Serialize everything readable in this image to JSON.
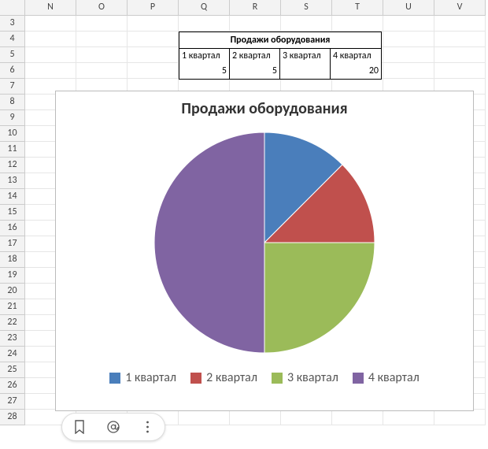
{
  "columns": [
    "N",
    "O",
    "P",
    "Q",
    "R",
    "S",
    "T",
    "U",
    "V"
  ],
  "row_numbers": [
    3,
    4,
    5,
    6,
    7,
    8,
    9,
    10,
    11,
    12,
    13,
    14,
    15,
    16,
    17,
    18,
    19,
    20,
    21,
    22,
    23,
    24,
    25,
    26,
    27,
    28
  ],
  "table": {
    "title": "Продажи оборудования",
    "headers": [
      "1 квартал",
      "2 квартал",
      "3 квартал",
      "4 квартал"
    ],
    "values": [
      "5",
      "5",
      "",
      "20"
    ]
  },
  "chart_data": {
    "type": "pie",
    "title": "Продажи оборудования",
    "categories": [
      "1 квартал",
      "2 квартал",
      "3 квартал",
      "4 квартал"
    ],
    "values": [
      5,
      5,
      10,
      20
    ],
    "colors": [
      "#4a7ebb",
      "#c0504d",
      "#9bbb59",
      "#8064a2"
    ],
    "legend_position": "bottom"
  },
  "legend": {
    "items": [
      {
        "label": "1 квартал",
        "color": "#4a7ebb"
      },
      {
        "label": "2 квартал",
        "color": "#c0504d"
      },
      {
        "label": "3 квартал",
        "color": "#9bbb59"
      },
      {
        "label": "4 квартал",
        "color": "#8064a2"
      }
    ]
  },
  "floatbar": {
    "icons": [
      "bookmark-icon",
      "mention-icon",
      "more-icon"
    ]
  }
}
